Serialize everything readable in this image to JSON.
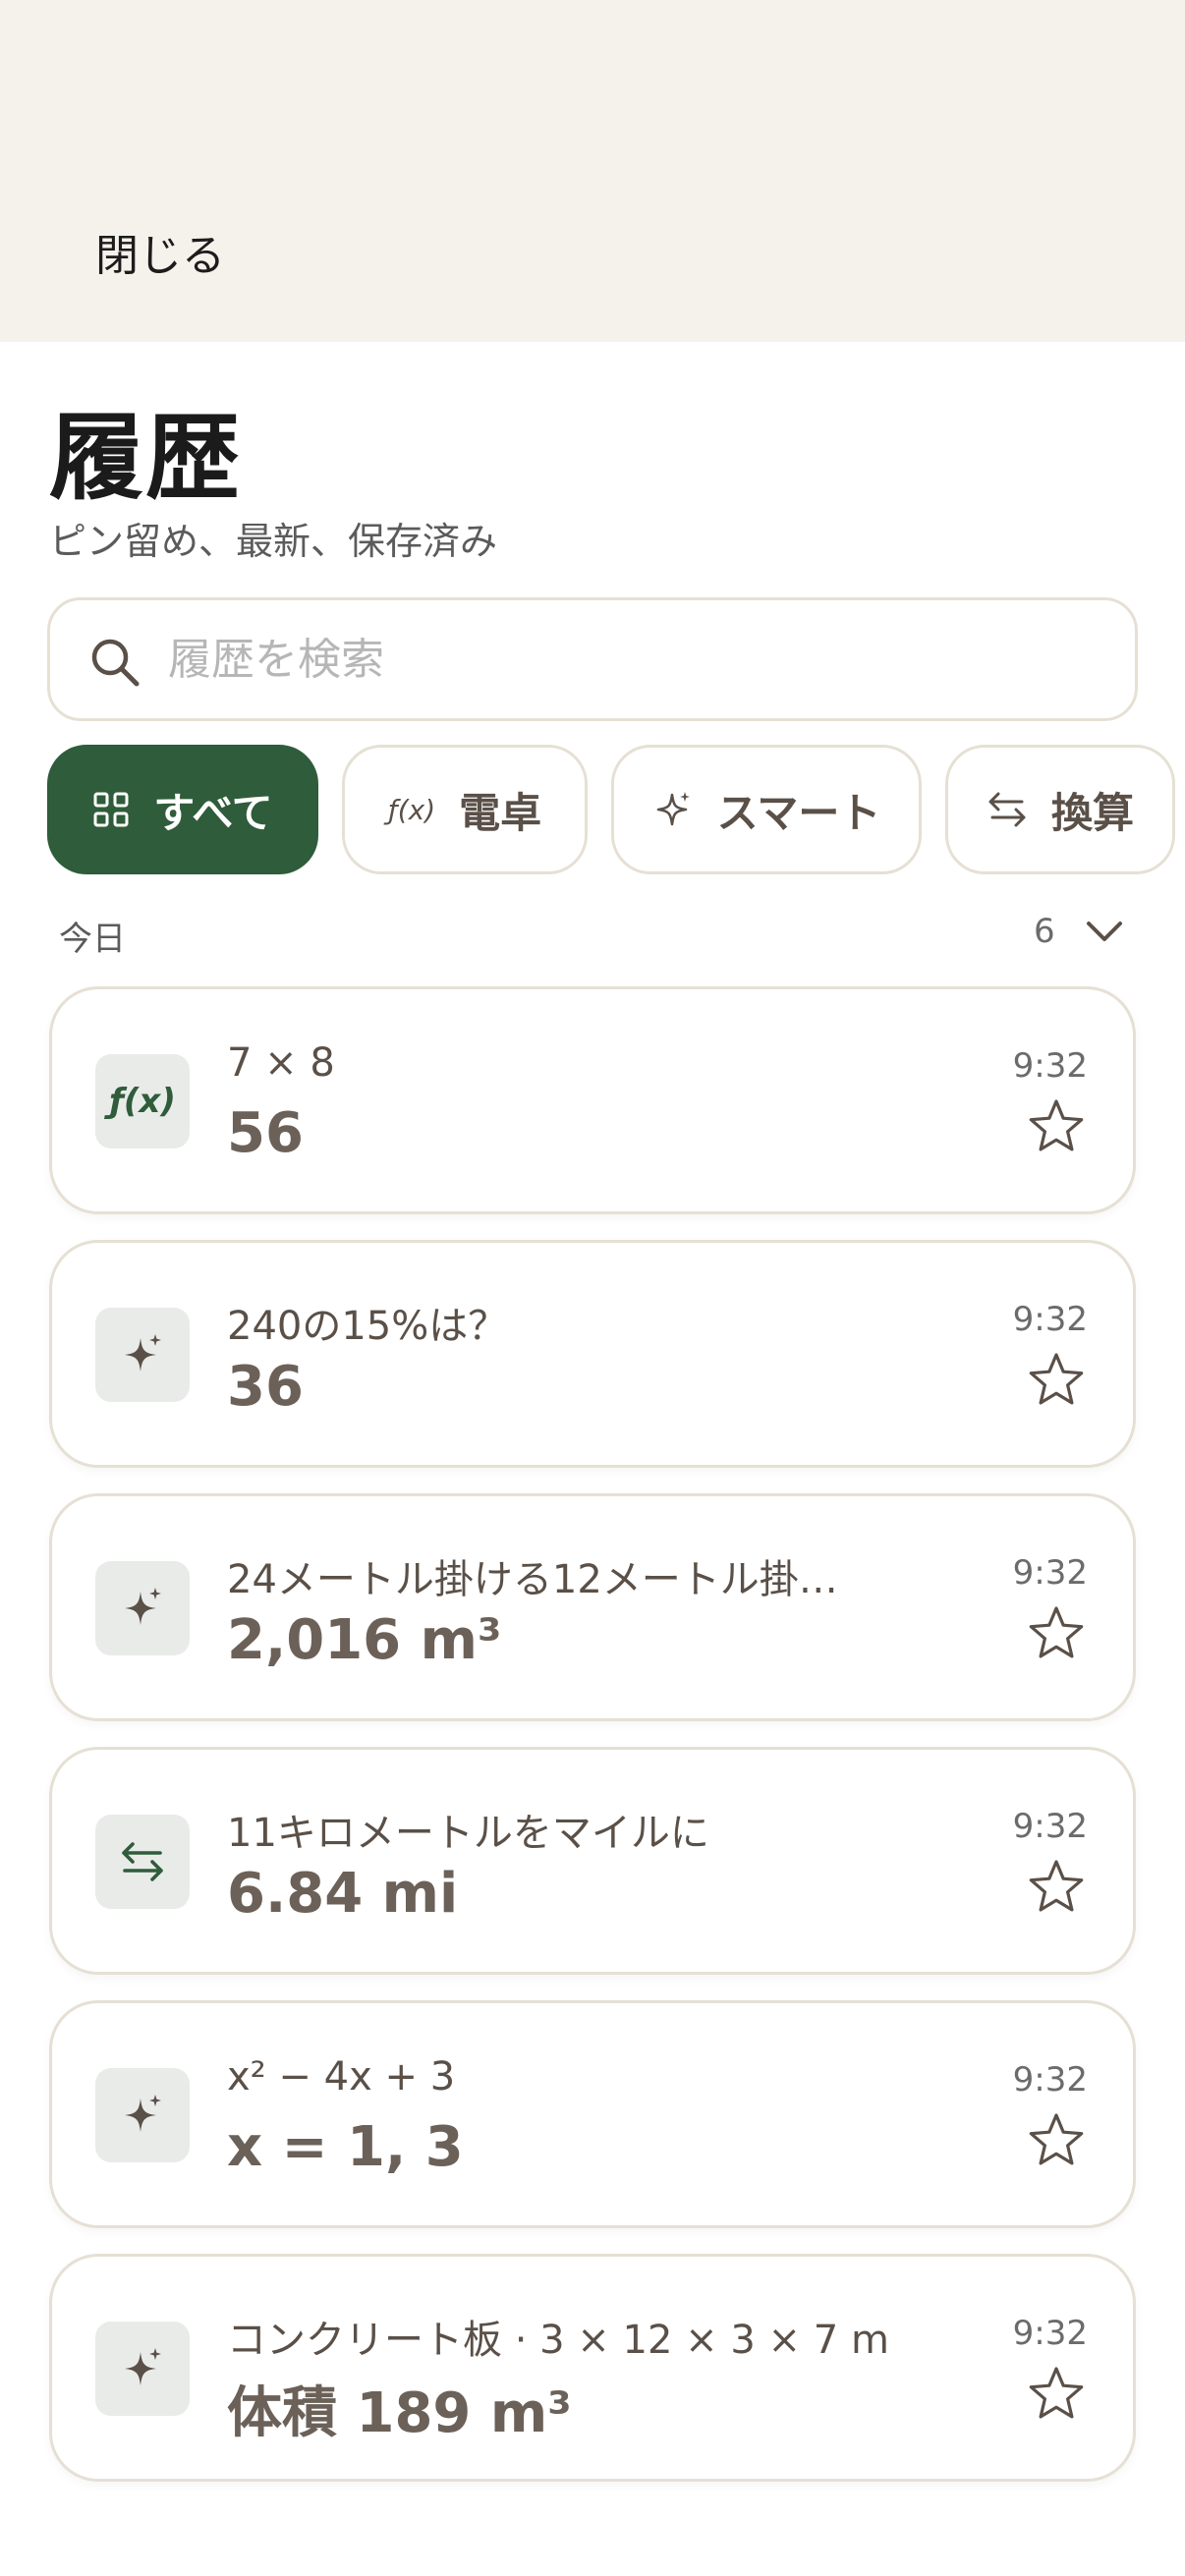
{
  "header": {
    "close_label": "閉じる"
  },
  "page": {
    "title": "履歴",
    "subtitle": "ピン留め、最新、保存済み"
  },
  "search": {
    "placeholder": "履歴を検索",
    "value": ""
  },
  "filters": [
    {
      "label": "すべて",
      "icon": "grid-icon",
      "active": true
    },
    {
      "label": "電卓",
      "icon": "fx-icon",
      "icon_text": "ƒ(x)",
      "active": false
    },
    {
      "label": "スマート",
      "icon": "sparkle-icon",
      "active": false
    },
    {
      "label": "換算",
      "icon": "swap-arrows-icon",
      "active": false
    }
  ],
  "section": {
    "label": "今日",
    "count": "6"
  },
  "history": [
    {
      "icon": "fx-icon",
      "icon_text": "ƒ(x)",
      "expression": "7 × 8",
      "result": "56",
      "time": "9:32"
    },
    {
      "icon": "sparkle-icon",
      "expression": "240の15%は？",
      "result": "36",
      "time": "9:32"
    },
    {
      "icon": "sparkle-icon",
      "expression": "24メートル掛ける12メートル掛…",
      "result": "2,016 m³",
      "time": "9:32"
    },
    {
      "icon": "swap-arrows-icon",
      "expression": "11キロメートルをマイルに",
      "result": "6.84 mi",
      "time": "9:32"
    },
    {
      "icon": "sparkle-icon",
      "expression": "x² − 4x + 3",
      "result": "x = 1, 3",
      "time": "9:32"
    },
    {
      "icon": "sparkle-icon",
      "expression": "コンクリート板 · 3 × 12 × 3 × 7 m",
      "result": "体積 189 m³",
      "time": "9:32"
    }
  ],
  "colors": {
    "accent": "#2f5c3a",
    "header_bg": "#f5f1eb",
    "border": "#e6e0d4"
  }
}
